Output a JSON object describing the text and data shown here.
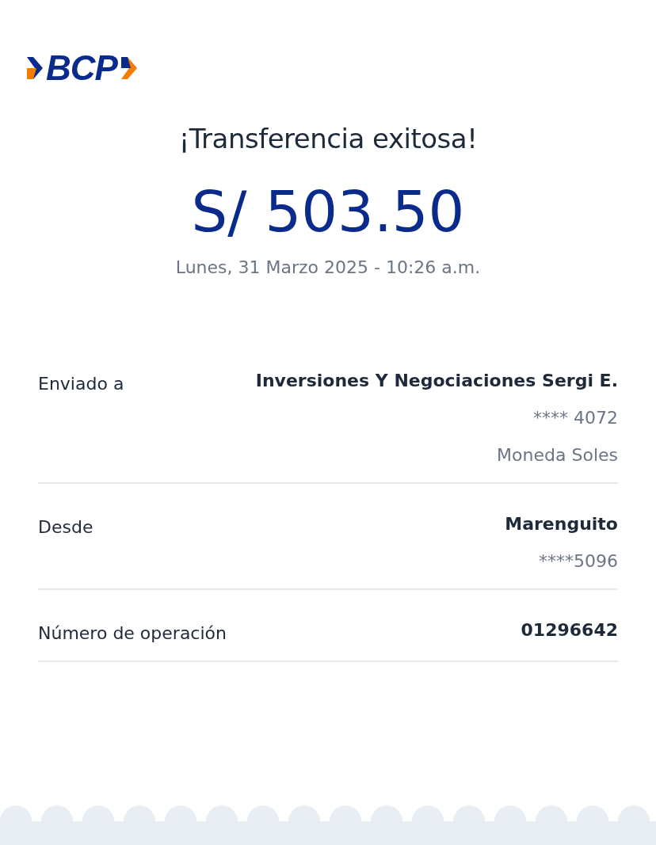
{
  "logo": {
    "text": "BCP"
  },
  "title": "¡Transferencia exitosa!",
  "amount": "S/ 503.50",
  "datetime": "Lunes, 31 Marzo 2025 - 10:26 a.m.",
  "details": [
    {
      "label": "Enviado a",
      "values": [
        {
          "text": "Inversiones Y Negociaciones Sergi E.",
          "kind": "strong"
        },
        {
          "text": "**** 4072",
          "kind": "muted"
        },
        {
          "text": "Moneda Soles",
          "kind": "muted"
        }
      ]
    },
    {
      "label": "Desde",
      "values": [
        {
          "text": "Marenguito",
          "kind": "strong"
        },
        {
          "text": "****5096",
          "kind": "muted"
        }
      ]
    },
    {
      "label": "Número de operación",
      "values": [
        {
          "text": "01296642",
          "kind": "strong"
        }
      ]
    }
  ]
}
